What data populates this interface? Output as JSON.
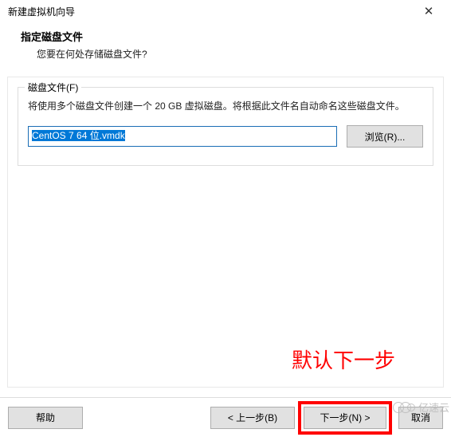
{
  "window": {
    "title": "新建虚拟机向导"
  },
  "header": {
    "title": "指定磁盘文件",
    "subtitle": "您要在何处存储磁盘文件?"
  },
  "fieldset": {
    "legend": "磁盘文件(F)",
    "description": "将使用多个磁盘文件创建一个 20 GB 虚拟磁盘。将根据此文件名自动命名这些磁盘文件。",
    "input_value": "CentOS 7 64 位.vmdk",
    "browse_label": "浏览(R)..."
  },
  "annotation": {
    "text": "默认下一步"
  },
  "buttons": {
    "help": "帮助",
    "back": "< 上一步(B)",
    "next": "下一步(N) >",
    "cancel": "取消"
  },
  "watermark": {
    "text": "亿速云"
  }
}
